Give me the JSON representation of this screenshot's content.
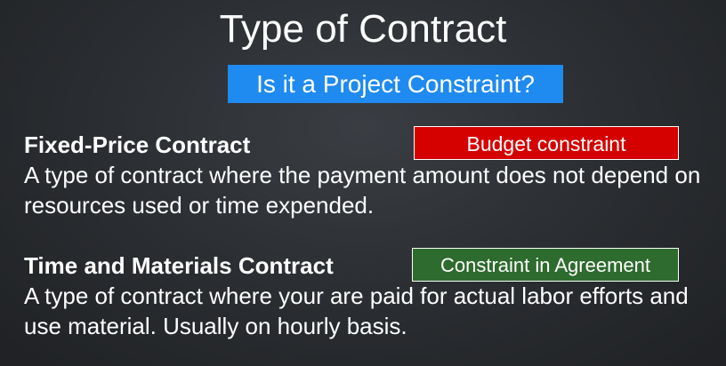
{
  "slide": {
    "title": "Type of Contract",
    "question": "Is it a Project Constraint?"
  },
  "sections": [
    {
      "heading": "Fixed-Price Contract",
      "tag": "Budget constraint",
      "tag_color": "#d50000",
      "description": "A type of contract where the payment amount does not depend on resources used or time expended."
    },
    {
      "heading": "Time and Materials Contract",
      "tag": "Constraint in Agreement",
      "tag_color": "#2e6b2e",
      "description": "A type of contract where your are paid for actual labor efforts and use material. Usually on hourly basis."
    }
  ],
  "colors": {
    "question_badge": "#1f8af0",
    "background": "#2c2f33",
    "text": "#ffffff"
  }
}
